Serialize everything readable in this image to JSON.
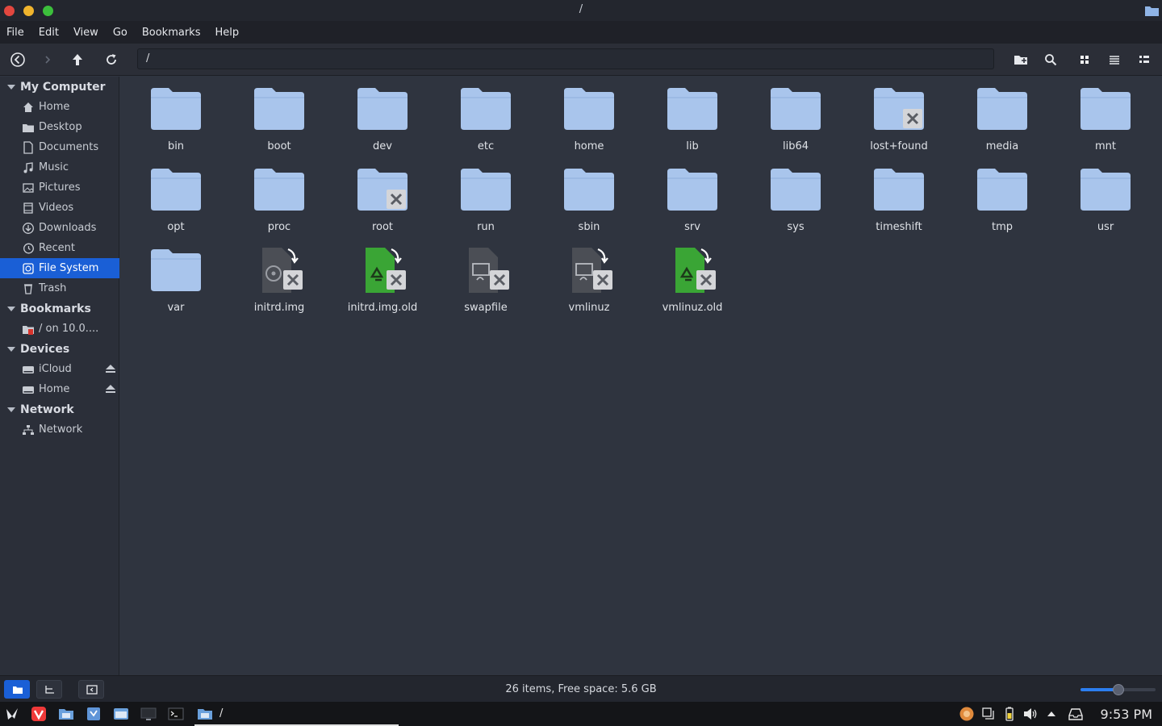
{
  "window": {
    "title": "/"
  },
  "menu": [
    "File",
    "Edit",
    "View",
    "Go",
    "Bookmarks",
    "Help"
  ],
  "toolbar": {
    "path": "/"
  },
  "sidebar": {
    "my_computer": {
      "header": "My Computer",
      "items": [
        {
          "label": "Home",
          "icon": "home-icon"
        },
        {
          "label": "Desktop",
          "icon": "desktop-icon"
        },
        {
          "label": "Documents",
          "icon": "documents-icon"
        },
        {
          "label": "Music",
          "icon": "music-icon"
        },
        {
          "label": "Pictures",
          "icon": "pictures-icon"
        },
        {
          "label": "Videos",
          "icon": "videos-icon"
        },
        {
          "label": "Downloads",
          "icon": "downloads-icon"
        },
        {
          "label": "Recent",
          "icon": "recent-icon"
        },
        {
          "label": "File System",
          "icon": "filesystem-icon",
          "selected": true
        },
        {
          "label": "Trash",
          "icon": "trash-icon"
        }
      ]
    },
    "bookmarks": {
      "header": "Bookmarks",
      "items": [
        {
          "label": "/ on 10.0...."
        }
      ]
    },
    "devices": {
      "header": "Devices",
      "items": [
        {
          "label": "iCloud"
        },
        {
          "label": "Home"
        }
      ]
    },
    "network": {
      "header": "Network",
      "items": [
        {
          "label": "Network"
        }
      ]
    }
  },
  "files": [
    {
      "name": "bin",
      "type": "folder"
    },
    {
      "name": "boot",
      "type": "folder"
    },
    {
      "name": "dev",
      "type": "folder"
    },
    {
      "name": "etc",
      "type": "folder"
    },
    {
      "name": "home",
      "type": "folder"
    },
    {
      "name": "lib",
      "type": "folder"
    },
    {
      "name": "lib64",
      "type": "folder"
    },
    {
      "name": "lost+found",
      "type": "folder-locked"
    },
    {
      "name": "media",
      "type": "folder"
    },
    {
      "name": "mnt",
      "type": "folder"
    },
    {
      "name": "opt",
      "type": "folder"
    },
    {
      "name": "proc",
      "type": "folder"
    },
    {
      "name": "root",
      "type": "folder-locked"
    },
    {
      "name": "run",
      "type": "folder"
    },
    {
      "name": "sbin",
      "type": "folder"
    },
    {
      "name": "srv",
      "type": "folder"
    },
    {
      "name": "sys",
      "type": "folder"
    },
    {
      "name": "timeshift",
      "type": "folder"
    },
    {
      "name": "tmp",
      "type": "folder"
    },
    {
      "name": "usr",
      "type": "folder"
    },
    {
      "name": "var",
      "type": "folder"
    },
    {
      "name": "initrd.img",
      "type": "link-disk"
    },
    {
      "name": "initrd.img.old",
      "type": "link-recycle"
    },
    {
      "name": "swapfile",
      "type": "file-locked"
    },
    {
      "name": "vmlinuz",
      "type": "link-exec"
    },
    {
      "name": "vmlinuz.old",
      "type": "link-recycle"
    }
  ],
  "status": {
    "text": "26 items, Free space: 5.6 GB",
    "zoom_level": 0.5
  },
  "taskbar": {
    "window_label": "/",
    "clock": "9:53 PM"
  },
  "colors": {
    "accent": "#1a5fd6",
    "folder": "#a9c5ec",
    "background": "#2f343f"
  }
}
